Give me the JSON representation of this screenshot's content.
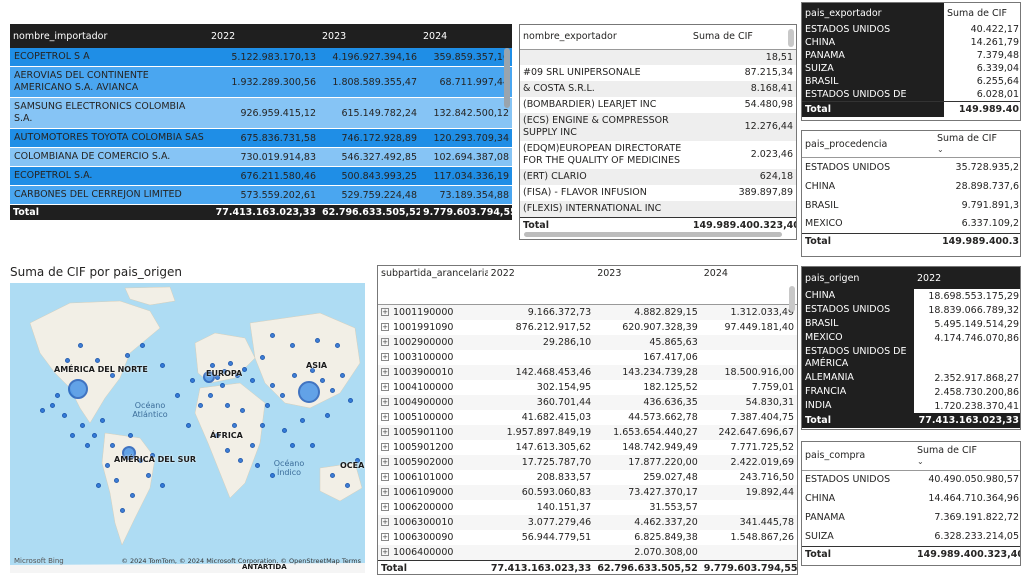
{
  "importador": {
    "headers": [
      "nombre_importador",
      "2022",
      "2023",
      "2024"
    ],
    "rows": [
      {
        "name": "ECOPETROL S A",
        "v": [
          "5.122.983.170,13",
          "4.196.927.394,16",
          "359.859.357,16"
        ]
      },
      {
        "name": "AEROVIAS DEL CONTINENTE AMERICANO S.A. AVIANCA",
        "v": [
          "1.932.289.300,56",
          "1.808.589.355,47",
          "68.711.997,44"
        ]
      },
      {
        "name": "SAMSUNG ELECTRONICS COLOMBIA S.A.",
        "v": [
          "926.959.415,12",
          "615.149.782,24",
          "132.842.500,12"
        ]
      },
      {
        "name": "AUTOMOTORES TOYOTA COLOMBIA SAS",
        "v": [
          "675.836.731,58",
          "746.172.928,89",
          "120.293.709,34"
        ]
      },
      {
        "name": "COLOMBIANA DE COMERCIO S.A.",
        "v": [
          "730.019.914,83",
          "546.327.492,85",
          "102.694.387,08"
        ]
      },
      {
        "name": "ECOPETROL S.A.",
        "v": [
          "676.211.580,46",
          "500.843.993,25",
          "117.034.336,19"
        ]
      },
      {
        "name": "CARBONES DEL CERREJON LIMITED",
        "v": [
          "573.559.202,61",
          "529.759.224,48",
          "73.189.354,88"
        ]
      }
    ],
    "total": {
      "label": "Total",
      "v": [
        "77.413.163.023,33",
        "62.796.633.505,52",
        "9.779.603.794,55"
      ]
    }
  },
  "exportador": {
    "headers": [
      "nombre_exportador",
      "Suma de CIF"
    ],
    "rows": [
      {
        "name": "",
        "v": "18,51"
      },
      {
        "name": "#09 SRL UNIPERSONALE",
        "v": "87.215,34"
      },
      {
        "name": "& COSTA S.R.L.",
        "v": "8.168,41"
      },
      {
        "name": "(BOMBARDIER) LEARJET INC",
        "v": "54.480,98"
      },
      {
        "name": "(ECS) ENGINE & COMPRESSOR SUPPLY INC",
        "v": "12.276,44"
      },
      {
        "name": "(EDQM)EUROPEAN DIRECTORATE FOR THE QUALITY OF MEDICINES",
        "v": "2.023,46"
      },
      {
        "name": "(ERT) CLARIO",
        "v": "624,18"
      },
      {
        "name": "(FISA) - FLAVOR INFUSION",
        "v": "389.897,89"
      },
      {
        "name": "(FLEXIS) INTERNATIONAL INC",
        "v": ""
      }
    ],
    "total": {
      "label": "Total",
      "v": "149.989.400.323,40"
    }
  },
  "pais_exportador": {
    "headers": [
      "pais_exportador",
      "Suma de CIF"
    ],
    "rows": [
      {
        "name": "ESTADOS UNIDOS",
        "v": "40.422,17"
      },
      {
        "name": "CHINA",
        "v": "14.261,79"
      },
      {
        "name": "PANAMA",
        "v": "7.379,48"
      },
      {
        "name": "SUIZA",
        "v": "6.339,04"
      },
      {
        "name": "BRASIL",
        "v": "6.255,64"
      },
      {
        "name": "ESTADOS UNIDOS DE",
        "v": "6.028,01"
      }
    ],
    "total": {
      "label": "Total",
      "v": "149.989.40"
    }
  },
  "pais_procedencia": {
    "headers": [
      "pais_procedencia",
      "Suma de CIF"
    ],
    "rows": [
      {
        "name": "ESTADOS UNIDOS",
        "v": "35.728.935,2"
      },
      {
        "name": "CHINA",
        "v": "28.898.737,6"
      },
      {
        "name": "BRASIL",
        "v": "9.791.891,3"
      },
      {
        "name": "MEXICO",
        "v": "6.337.109,2"
      }
    ],
    "total": {
      "label": "Total",
      "v": "149.989.400.3"
    }
  },
  "map": {
    "title": "Suma de CIF por pais_origen",
    "labels": {
      "na": "AMÉRICA DEL NORTE",
      "eu": "EUROPA",
      "asia": "ASIA",
      "africa": "ÁFRICA",
      "sa": "AMÉRICA DEL SUR",
      "oceania": "OCEAN",
      "antartida": "ANTÁRTIDA"
    },
    "oceans": {
      "atlantic": "Océano Atlántico",
      "indian": "Océano Índico"
    },
    "brand": "Microsoft Bing",
    "attribution": "© 2024 TomTom, © 2024 Microsoft Corporation, © OpenStreetMap  Terms"
  },
  "subpartida": {
    "headers": [
      "subpartida_arancelaria",
      "2022",
      "2023",
      "2024"
    ],
    "rows": [
      {
        "code": "1001190000",
        "v": [
          "9.166.372,73",
          "4.882.829,15",
          "1.312.033,49"
        ]
      },
      {
        "code": "1001991090",
        "v": [
          "876.212.917,52",
          "620.907.328,39",
          "97.449.181,40"
        ]
      },
      {
        "code": "1002900000",
        "v": [
          "29.286,10",
          "45.865,63",
          ""
        ]
      },
      {
        "code": "1003100000",
        "v": [
          "",
          "167.417,06",
          ""
        ]
      },
      {
        "code": "1003900010",
        "v": [
          "142.468.453,46",
          "143.234.739,28",
          "18.500.916,00"
        ]
      },
      {
        "code": "1004100000",
        "v": [
          "302.154,95",
          "182.125,52",
          "7.759,01"
        ]
      },
      {
        "code": "1004900000",
        "v": [
          "360.701,44",
          "436.636,35",
          "54.830,31"
        ]
      },
      {
        "code": "1005100000",
        "v": [
          "41.682.415,03",
          "44.573.662,78",
          "7.387.404,75"
        ]
      },
      {
        "code": "1005901100",
        "v": [
          "1.957.897.849,19",
          "1.653.654.440,27",
          "242.647.696,67"
        ]
      },
      {
        "code": "1005901200",
        "v": [
          "147.613.305,62",
          "148.742.949,49",
          "7.771.725,52"
        ]
      },
      {
        "code": "1005902000",
        "v": [
          "17.725.787,70",
          "17.877.220,00",
          "2.422.019,69"
        ]
      },
      {
        "code": "1006101000",
        "v": [
          "208.833,57",
          "259.027,48",
          "243.716,50"
        ]
      },
      {
        "code": "1006109000",
        "v": [
          "60.593.060,83",
          "73.427.370,17",
          "19.892,44"
        ]
      },
      {
        "code": "1006200000",
        "v": [
          "140.151,37",
          "31.553,57",
          ""
        ]
      },
      {
        "code": "1006300010",
        "v": [
          "3.077.279,46",
          "4.462.337,20",
          "341.445,78"
        ]
      },
      {
        "code": "1006300090",
        "v": [
          "56.944.779,51",
          "6.825.849,38",
          "1.548.867,26"
        ]
      },
      {
        "code": "1006400000",
        "v": [
          "",
          "2.070.308,00",
          ""
        ]
      }
    ],
    "total": {
      "label": "Total",
      "v": [
        "77.413.163.023,33",
        "62.796.633.505,52",
        "9.779.603.794,55"
      ]
    }
  },
  "pais_origen": {
    "headers": [
      "pais_origen",
      "2022"
    ],
    "rows": [
      {
        "name": "CHINA",
        "v": "18.698.553.175,29"
      },
      {
        "name": "ESTADOS UNIDOS",
        "v": "18.839.066.789,32"
      },
      {
        "name": "BRASIL",
        "v": "5.495.149.514,29"
      },
      {
        "name": "MEXICO",
        "v": "4.174.746.070,86"
      },
      {
        "name": "ESTADOS UNIDOS DE AMÉRICA",
        "v": ""
      },
      {
        "name": "ALEMANIA",
        "v": "2.352.917.868,27"
      },
      {
        "name": "FRANCIA",
        "v": "2.458.730.200,86"
      },
      {
        "name": "INDIA",
        "v": "1.720.238.370,41"
      }
    ],
    "total": {
      "label": "Total",
      "v": "77.413.163.023,33"
    }
  },
  "pais_compra": {
    "headers": [
      "pais_compra",
      "Suma de CIF"
    ],
    "rows": [
      {
        "name": "ESTADOS UNIDOS",
        "v": "40.490.050.980,57"
      },
      {
        "name": "CHINA",
        "v": "14.464.710.364,96"
      },
      {
        "name": "PANAMA",
        "v": "7.369.191.822,72"
      },
      {
        "name": "SUIZA",
        "v": "6.328.233.214,05"
      }
    ],
    "total": {
      "label": "Total",
      "v": "149.989.400.323,40"
    }
  },
  "colors": {
    "dark": "#1f1f1f",
    "blue1": "#1f8ee6",
    "blue2": "#4aa6f0",
    "blue3": "#86c4f5",
    "mapwater": "#aedcf3",
    "mapdot": "#1f6bd6"
  }
}
